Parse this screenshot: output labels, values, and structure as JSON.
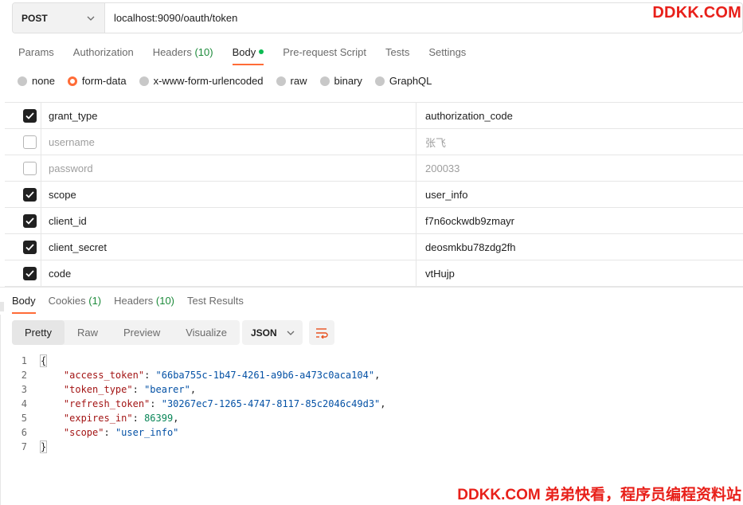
{
  "request": {
    "method": "POST",
    "url": "localhost:9090/oauth/token"
  },
  "watermark_top": "DDKK.COM",
  "watermark_bottom": "DDKK.COM 弟弟快看，程序员编程资料站",
  "request_tabs": [
    {
      "label": "Params",
      "count": ""
    },
    {
      "label": "Authorization",
      "count": ""
    },
    {
      "label": "Headers",
      "count": "(10)"
    },
    {
      "label": "Body",
      "count": "",
      "active": true,
      "indicator": "green-dot"
    },
    {
      "label": "Pre-request Script",
      "count": ""
    },
    {
      "label": "Tests",
      "count": ""
    },
    {
      "label": "Settings",
      "count": ""
    }
  ],
  "body_types": [
    {
      "label": "none",
      "selected": false
    },
    {
      "label": "form-data",
      "selected": true
    },
    {
      "label": "x-www-form-urlencoded",
      "selected": false
    },
    {
      "label": "raw",
      "selected": false
    },
    {
      "label": "binary",
      "selected": false
    },
    {
      "label": "GraphQL",
      "selected": false
    }
  ],
  "form_rows": [
    {
      "checked": true,
      "key": "grant_type",
      "value": "authorization_code"
    },
    {
      "checked": false,
      "key": "username",
      "value": "张飞"
    },
    {
      "checked": false,
      "key": "password",
      "value": "200033"
    },
    {
      "checked": true,
      "key": "scope",
      "value": "user_info"
    },
    {
      "checked": true,
      "key": "client_id",
      "value": "f7n6ockwdb9zmayr"
    },
    {
      "checked": true,
      "key": "client_secret",
      "value": "deosmkbu78zdg2fh"
    },
    {
      "checked": true,
      "key": "code",
      "value": "vtHujp"
    }
  ],
  "response_tabs": [
    {
      "label": "Body",
      "count": "",
      "active": true
    },
    {
      "label": "Cookies",
      "count": "(1)"
    },
    {
      "label": "Headers",
      "count": "(10)"
    },
    {
      "label": "Test Results",
      "count": ""
    }
  ],
  "view_modes": [
    {
      "label": "Pretty",
      "active": true
    },
    {
      "label": "Raw"
    },
    {
      "label": "Preview"
    },
    {
      "label": "Visualize"
    }
  ],
  "format": "JSON",
  "response_lines": [
    {
      "n": "1",
      "text": "{"
    },
    {
      "n": "2",
      "key": "\"access_token\"",
      "value": "\"66ba755c-1b47-4261-a9b6-a473c0aca104\"",
      "type": "string",
      "comma": ","
    },
    {
      "n": "3",
      "key": "\"token_type\"",
      "value": "\"bearer\"",
      "type": "string",
      "comma": ","
    },
    {
      "n": "4",
      "key": "\"refresh_token\"",
      "value": "\"30267ec7-1265-4747-8117-85c2046c49d3\"",
      "type": "string",
      "comma": ","
    },
    {
      "n": "5",
      "key": "\"expires_in\"",
      "value": "86399",
      "type": "number",
      "comma": ","
    },
    {
      "n": "6",
      "key": "\"scope\"",
      "value": "\"user_info\"",
      "type": "string",
      "comma": ""
    },
    {
      "n": "7",
      "text": "}"
    }
  ],
  "colors": {
    "accent": "#ff6c37",
    "active_dot": "#0cbb52",
    "count_green": "#1c8a3a",
    "watermark": "#e8201a"
  }
}
